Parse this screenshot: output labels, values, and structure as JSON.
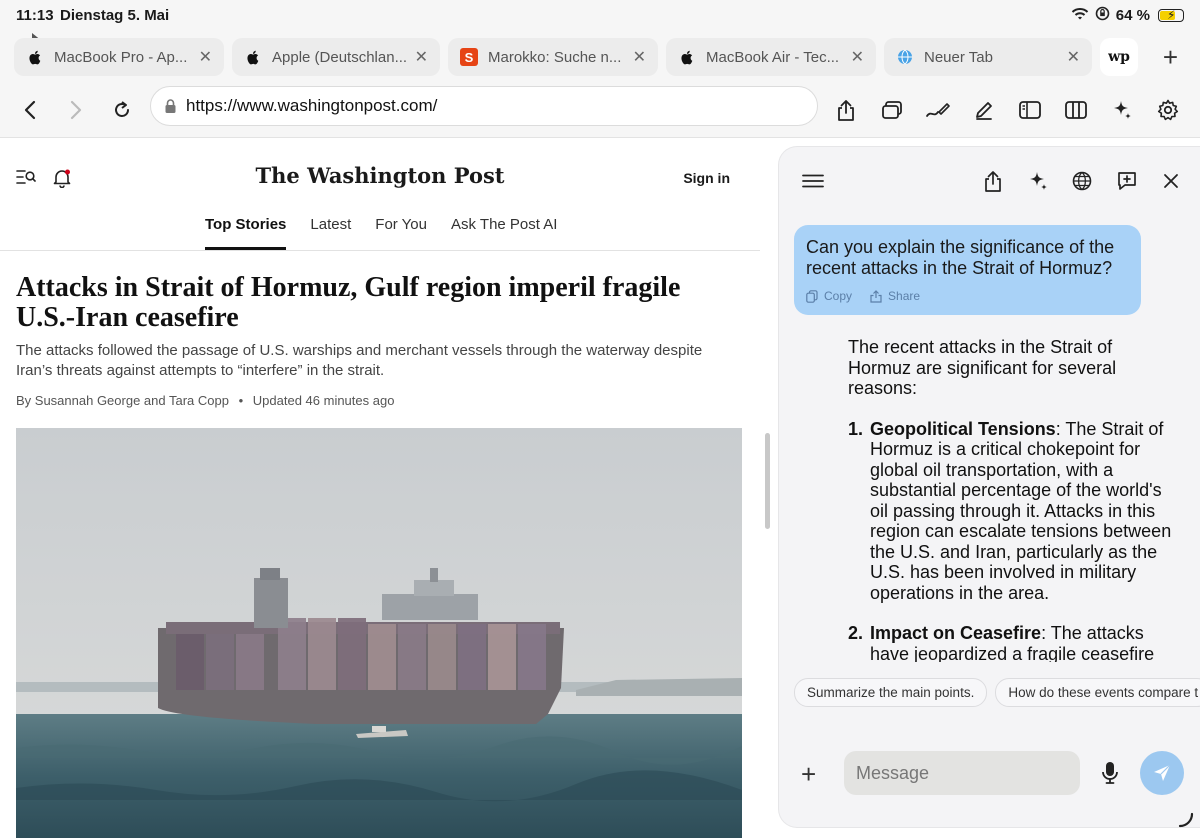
{
  "status": {
    "time": "11:13",
    "date": "Dienstag 5. Mai",
    "battery": "64 %",
    "battery_level": 0.64
  },
  "tabs": [
    {
      "label": "MacBook Pro - Ap...",
      "icon": "apple-icon"
    },
    {
      "label": "Apple (Deutschlan...",
      "icon": "apple-icon"
    },
    {
      "label": "Marokko: Suche n...",
      "icon": "spiegel-icon"
    },
    {
      "label": "MacBook Air - Tec...",
      "icon": "apple-icon"
    },
    {
      "label": "Neuer Tab",
      "icon": "globe-icon"
    },
    {
      "label": "wp",
      "icon": "washington-post-icon"
    }
  ],
  "toolbar": {
    "url": "https://www.washingtonpost.com/"
  },
  "site": {
    "logo": "The Washington Post",
    "signin": "Sign in",
    "nav": [
      "Top Stories",
      "Latest",
      "For You",
      "Ask The Post AI"
    ],
    "active_nav": "Top Stories"
  },
  "article": {
    "headline": "Attacks in Strait of Hormuz, Gulf region imperil fragile U.S.-Iran ceasefire",
    "dek": "The attacks followed the passage of U.S. warships and merchant vessels through the waterway despite Iran’s threats against attempts to “interfere” in the strait.",
    "byline": "By Susannah George and Tara Copp",
    "bullet": "•",
    "updated": "Updated 46 minutes ago"
  },
  "assistant": {
    "question": "Can you explain the significance of the recent attacks in the Strait of Hormuz?",
    "copy_label": "Copy",
    "share_label": "Share",
    "answer_intro": "The recent attacks in the Strait of Hormuz are significant for several reasons:",
    "points": [
      {
        "num": "1.",
        "title": "Geopolitical Tensions",
        "text": ": The Strait of Hormuz is a critical chokepoint for global oil transportation, with a substantial percentage of the world's oil passing through it. Attacks in this region can escalate tensions between the U.S. and Iran, particularly as the U.S. has been involved in military operations in the area."
      },
      {
        "num": "2.",
        "title": "Impact on Ceasefire",
        "text": ": The attacks have jeopardized a fragile ceasefire between the U.S. and Iran. This ceasefire is"
      }
    ],
    "suggestions": [
      "Summarize the main points.",
      "How do these events compare t"
    ],
    "message_placeholder": "Message"
  }
}
